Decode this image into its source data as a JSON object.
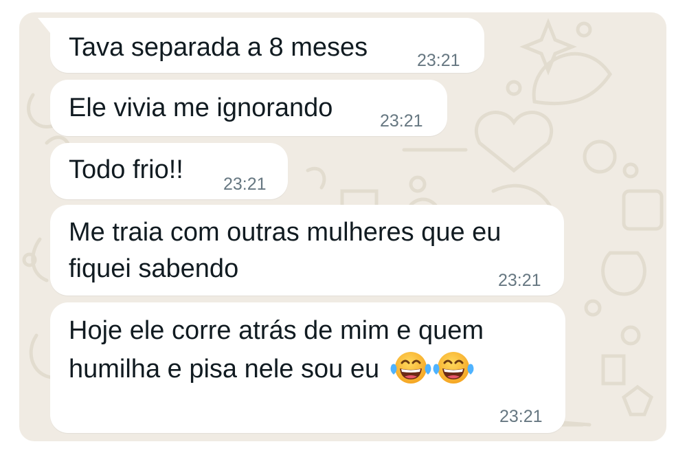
{
  "chat": {
    "messages": [
      {
        "text": "Tava separada a 8 meses",
        "time": "23:21"
      },
      {
        "text": "Ele vivia me ignorando",
        "time": "23:21"
      },
      {
        "text": "Todo frio!!",
        "time": "23:21"
      },
      {
        "line1": "Me traia com outras mulheres que eu",
        "line2": "fiquei sabendo",
        "time": "23:21"
      },
      {
        "line1": "Hoje ele corre atrás de mim e quem",
        "line2": "humilha e pisa nele sou eu",
        "emoji": "face-with-tears-of-joy x2",
        "time": "23:21"
      }
    ]
  },
  "colors": {
    "wallpaper": "#f0ebe3",
    "bubble": "#ffffff",
    "text": "#111b21",
    "timestamp": "#667781",
    "doodle": "#e2dccf"
  }
}
